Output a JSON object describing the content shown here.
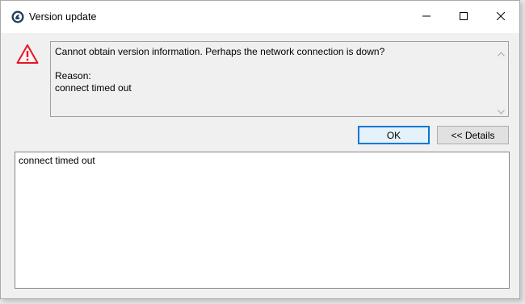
{
  "window": {
    "title": "Version update",
    "icon": "app-icon",
    "controls": {
      "minimize": "minimize-icon",
      "maximize": "maximize-icon",
      "close": "close-icon"
    }
  },
  "message": {
    "icon": "warning-icon",
    "line1": "Cannot obtain version information. Perhaps the network connection is down?",
    "reason_label": "Reason:",
    "reason": "connect timed out"
  },
  "buttons": {
    "ok": "OK",
    "details": "<< Details"
  },
  "details": {
    "text": "connect timed out"
  },
  "colors": {
    "warning": "#e81123",
    "focus": "#0078d7"
  }
}
